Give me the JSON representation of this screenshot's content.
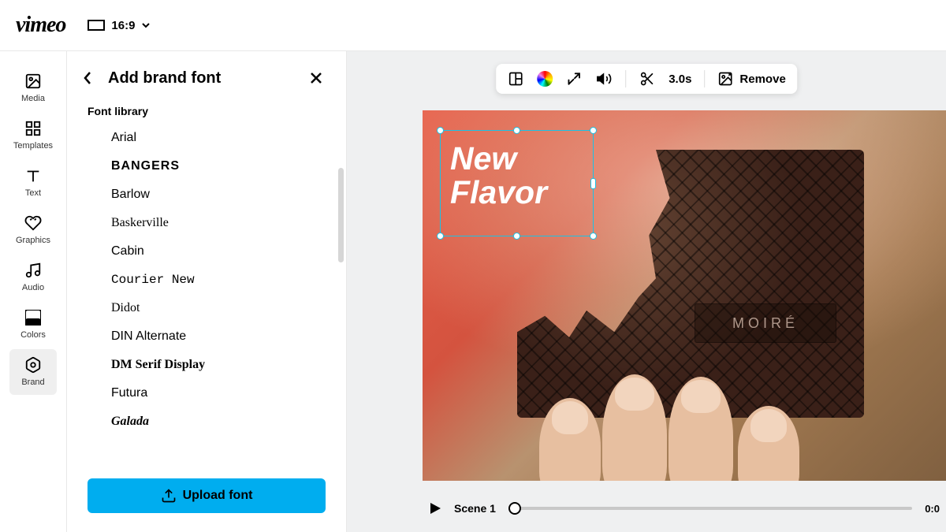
{
  "topbar": {
    "aspect_ratio": "16:9"
  },
  "sidebar": {
    "items": [
      {
        "label": "Media"
      },
      {
        "label": "Templates"
      },
      {
        "label": "Text"
      },
      {
        "label": "Graphics"
      },
      {
        "label": "Audio"
      },
      {
        "label": "Colors"
      },
      {
        "label": "Brand"
      }
    ]
  },
  "panel": {
    "title": "Add brand font",
    "subheader": "Font library",
    "fonts": [
      {
        "name": "Arial",
        "css": "Arial, sans-serif"
      },
      {
        "name": "BANGERS",
        "css": "Impact, sans-serif",
        "weight": "900",
        "ls": "1px"
      },
      {
        "name": "Barlow",
        "css": "Helvetica, Arial, sans-serif"
      },
      {
        "name": "Baskerville",
        "css": "Baskerville, Georgia, serif"
      },
      {
        "name": "Cabin",
        "css": "Arial, sans-serif"
      },
      {
        "name": "Courier New",
        "css": "'Courier New', monospace"
      },
      {
        "name": "Didot",
        "css": "Didot, Georgia, serif"
      },
      {
        "name": "DIN Alternate",
        "css": "Helvetica, Arial, sans-serif",
        "weight": "500"
      },
      {
        "name": "DM Serif Display",
        "css": "Georgia, serif",
        "weight": "700"
      },
      {
        "name": "Futura",
        "css": "Futura, 'Trebuchet MS', sans-serif"
      },
      {
        "name": "Galada",
        "css": "cursive",
        "style": "italic",
        "weight": "700"
      }
    ],
    "upload_label": "Upload font"
  },
  "toolbar": {
    "duration": "3.0s",
    "remove_label": "Remove"
  },
  "canvas": {
    "text_line1": "New",
    "text_line2": "Flavor",
    "product_label": "MOIRÉ"
  },
  "timeline": {
    "scene_label": "Scene 1",
    "end_time": "0:0"
  }
}
